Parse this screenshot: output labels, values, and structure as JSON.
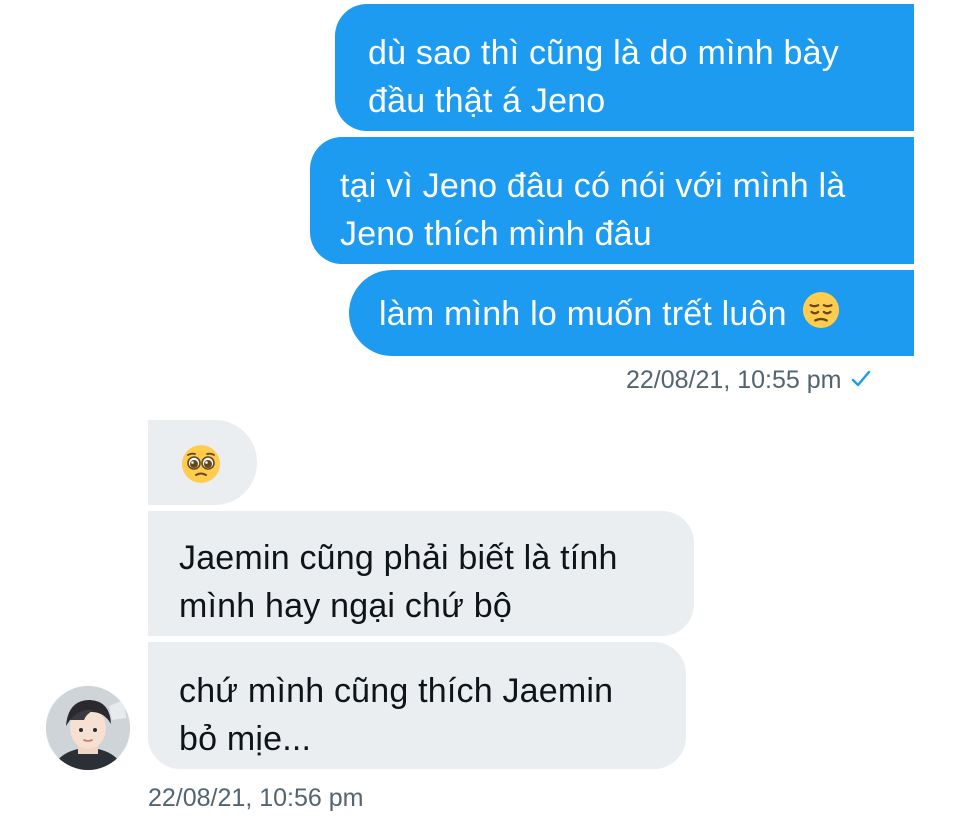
{
  "conversation": {
    "sent_group": {
      "messages": [
        {
          "lines": [
            "dù sao thì cũng là do mình bày",
            "đầu thật á Jeno"
          ]
        },
        {
          "lines": [
            "tại vì Jeno đâu có nói với mình là",
            "Jeno thích mình đâu"
          ]
        },
        {
          "text": "làm mình lo muốn trết luôn",
          "emoji": "pensive-face-emoji"
        }
      ],
      "timestamp": "22/08/21, 10:55 pm",
      "status_icon": "checkmark-icon"
    },
    "received_group": {
      "messages": [
        {
          "emoji": "pleading-face-emoji"
        },
        {
          "lines": [
            "Jaemin cũng phải biết là tính",
            "mình hay ngại chứ bộ"
          ]
        },
        {
          "lines": [
            "chứ mình cũng thích Jaemin",
            "bỏ mịe..."
          ]
        }
      ],
      "timestamp": "22/08/21, 10:56 pm",
      "avatar": "user-avatar"
    }
  },
  "colors": {
    "sent_bubble": "#1d9bf0",
    "received_bubble": "#ebeef0",
    "timestamp_text": "#536471",
    "check": "#1d9bf0"
  }
}
